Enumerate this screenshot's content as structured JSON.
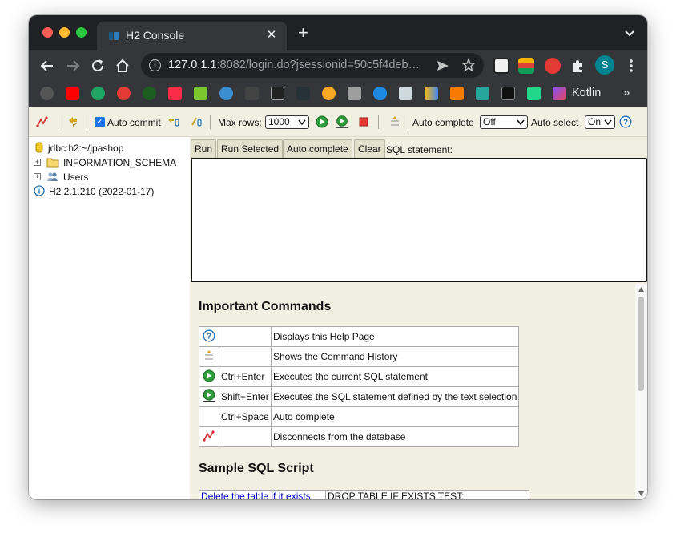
{
  "browser": {
    "tab_title": "H2 Console",
    "tab_close_glyph": "✕",
    "new_tab_glyph": "+",
    "url_host": "127.0.1.1",
    "url_rest": ":8082/login.do?jsessionid=50c5f4deb…",
    "avatar_initial": "S",
    "bookmark_kotlin": "Kotlin",
    "bookmark_more": "»",
    "icons": [
      "back-icon",
      "forward-icon",
      "reload-icon",
      "home-icon",
      "info-icon",
      "send-icon",
      "star-icon",
      "notion-icon",
      "extension-icon",
      "puzzle-icon",
      "more-vert-icon"
    ]
  },
  "h2_toolbar": {
    "auto_commit_label": "Auto commit",
    "max_rows_label": "Max rows:",
    "max_rows_value": "1000",
    "auto_complete_label": "Auto complete",
    "auto_complete_value": "Off",
    "auto_select_label": "Auto select",
    "auto_select_value": "On",
    "auto_commit_checked": true
  },
  "tree": {
    "connection": "jdbc:h2:~/jpashop",
    "schema": "INFORMATION_SCHEMA",
    "users": "Users",
    "version": "H2 2.1.210 (2022-01-17)"
  },
  "query": {
    "run": "Run",
    "run_selected": "Run Selected",
    "auto_complete": "Auto complete",
    "clear": "Clear",
    "sql_label": "SQL statement:"
  },
  "help": {
    "title": "Important Commands",
    "commands": [
      {
        "icon": "help-icon",
        "key": "",
        "desc": "Displays this Help Page"
      },
      {
        "icon": "history-icon",
        "key": "",
        "desc": "Shows the Command History"
      },
      {
        "icon": "run-icon",
        "key": "Ctrl+Enter",
        "desc": "Executes the current SQL statement"
      },
      {
        "icon": "run-selected-icon",
        "key": "Shift+Enter",
        "desc": "Executes the SQL statement defined by the text selection"
      },
      {
        "icon": "",
        "key": "Ctrl+Space",
        "desc": "Auto complete"
      },
      {
        "icon": "disconnect-icon",
        "key": "",
        "desc": "Disconnects from the database"
      }
    ],
    "sample_title": "Sample SQL Script",
    "sample_rows": [
      {
        "link": "Delete the table if it exists",
        "sql": "DROP TABLE IF EXISTS TEST;"
      }
    ]
  },
  "colors": {
    "h2_background": "#f1efe1",
    "chrome_dark": "#202124",
    "chrome_toolbar": "#35363a"
  }
}
